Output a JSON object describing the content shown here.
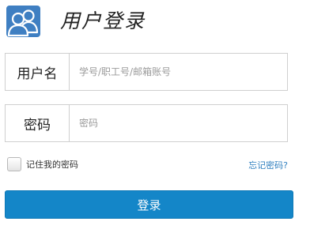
{
  "header": {
    "title": "用户登录",
    "logo_icon": "users-icon",
    "logo_color": "#3f7fc2"
  },
  "form": {
    "username": {
      "label": "用户名",
      "placeholder": "学号/职工号/邮箱账号",
      "value": ""
    },
    "password": {
      "label": "密码",
      "placeholder": "密码",
      "value": ""
    },
    "remember": {
      "label": "记住我的密码",
      "checked": false
    },
    "forgot_label": "忘记密码?",
    "submit_label": "登录"
  },
  "colors": {
    "accent": "#1486c8",
    "link": "#2f7fbf"
  }
}
